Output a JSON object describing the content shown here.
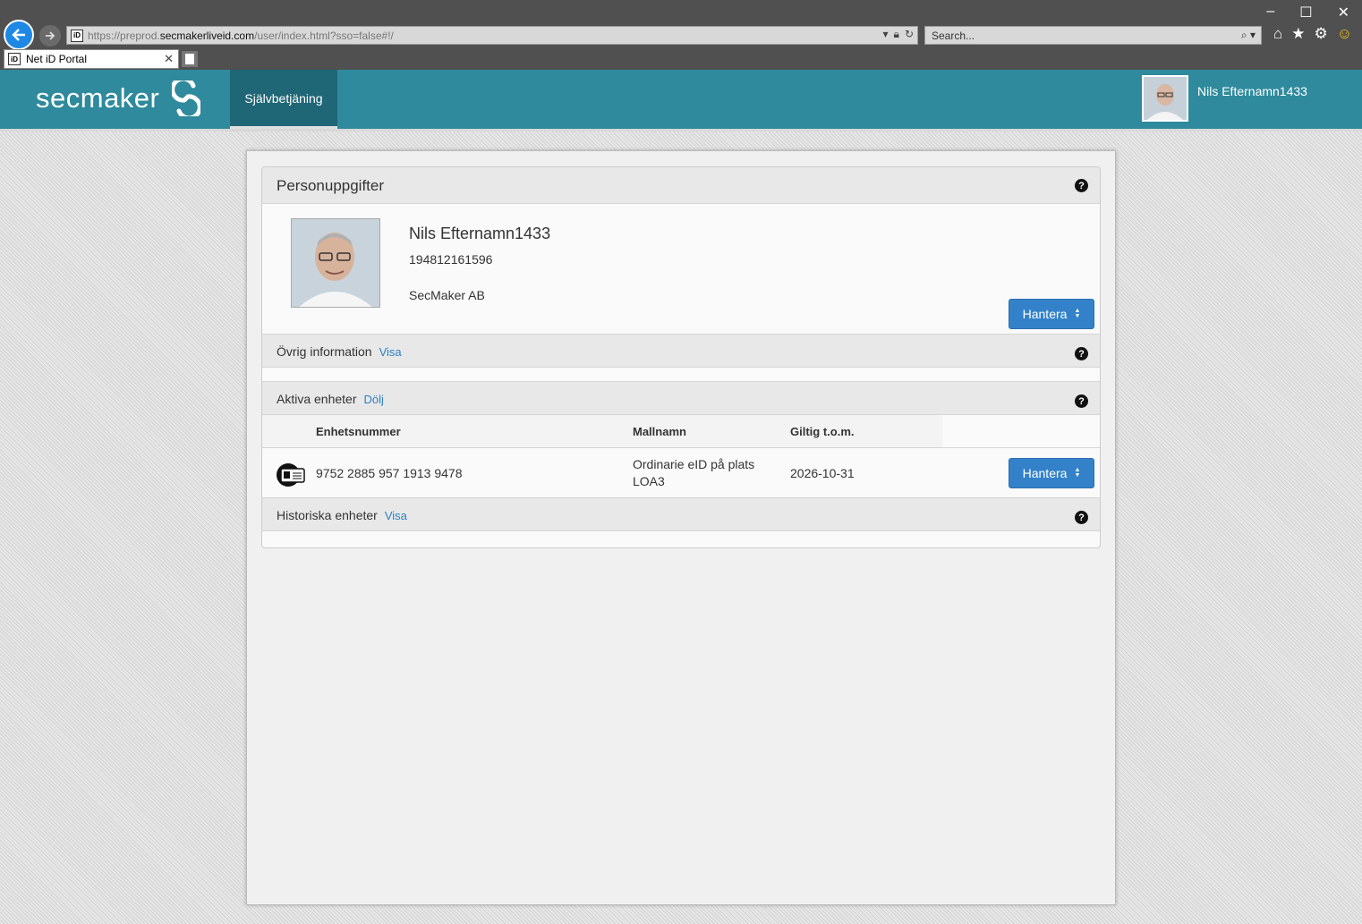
{
  "browser": {
    "url_prefix": "https://",
    "url_sub": "preprod.",
    "url_host": "secmakerliveid.com",
    "url_path": "/user/index.html?sso=false#!/",
    "search_placeholder": "Search...",
    "tab_title": "Net iD Portal",
    "favicon_text": "iD"
  },
  "header": {
    "logo_text": "secmaker",
    "nav_tab": "Självbetjäning",
    "user_name": "Nils Efternamn1433"
  },
  "personal": {
    "title": "Personuppgifter",
    "name": "Nils Efternamn1433",
    "personal_number": "194812161596",
    "organization": "SecMaker AB",
    "manage_label": "Hantera"
  },
  "other_info": {
    "label": "Övrig information",
    "link": "Visa"
  },
  "active_devices": {
    "label": "Aktiva enheter",
    "link": "Dölj",
    "columns": [
      "Enhetsnummer",
      "Mallnamn",
      "Giltig t.o.m."
    ],
    "rows": [
      {
        "number": "9752 2885 957 1913 9478",
        "template_line1": "Ordinarie eID på plats",
        "template_line2": "LOA3",
        "valid_to": "2026-10-31",
        "manage_label": "Hantera"
      }
    ]
  },
  "historic_devices": {
    "label": "Historiska enheter",
    "link": "Visa"
  },
  "colors": {
    "header_teal": "#2e8a9c",
    "nav_active": "#1f6676",
    "button_blue": "#3382c9",
    "link_blue": "#2d7fc4"
  }
}
